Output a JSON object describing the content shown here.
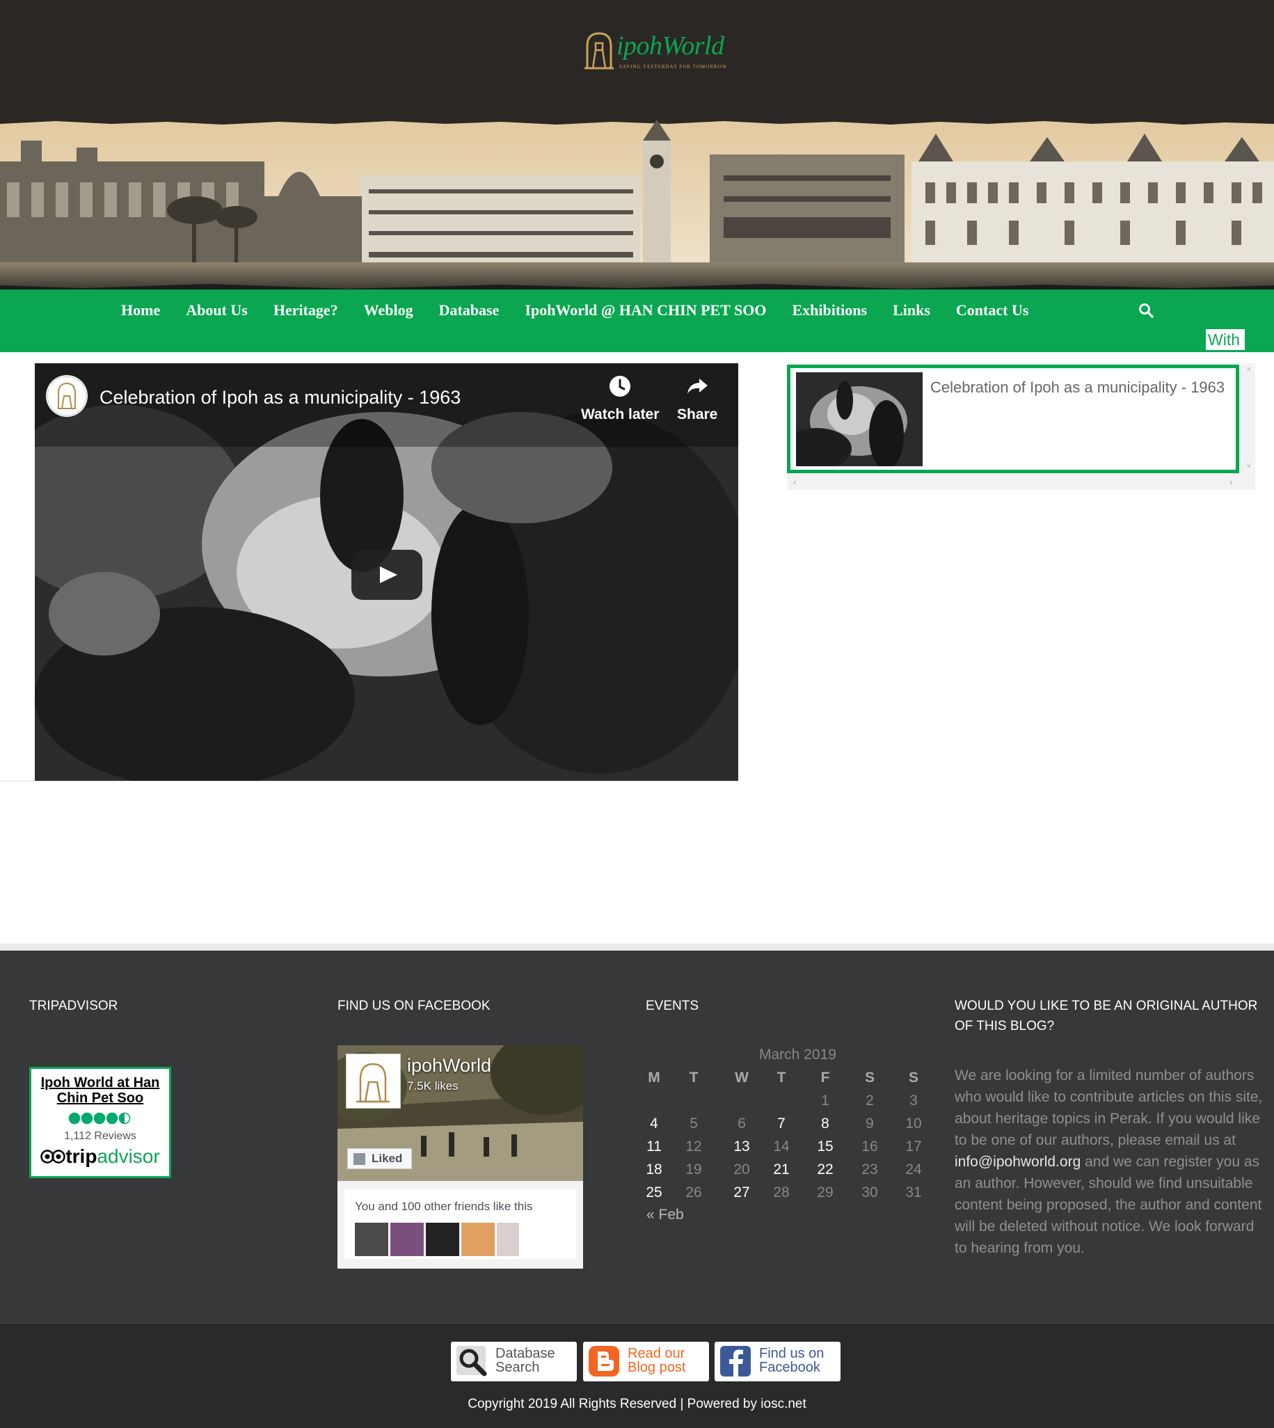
{
  "header": {
    "logo_text": "ipohWorld",
    "logo_tagline": "SAVING YESTERDAY FOR TOMORROW"
  },
  "nav": {
    "items": [
      "Home",
      "About Us",
      "Heritage?",
      "Weblog",
      "Database",
      "IpohWorld @ HAN CHIN PET SOO",
      "Exhibitions",
      "Links",
      "Contact Us"
    ],
    "ticker": "With r"
  },
  "video": {
    "title": "Celebration of Ipoh as a municipality - 1963",
    "watch_later": "Watch later",
    "share": "Share"
  },
  "playlist": {
    "items": [
      {
        "title": "Celebration of Ipoh as a municipality - 1963"
      }
    ]
  },
  "footer": {
    "tripadvisor": {
      "heading": "TRIPADVISOR",
      "title": "Ipoh World at Han Chin Pet Soo",
      "rating": 4.5,
      "reviews": "1,112 Reviews",
      "brand_a": "trip",
      "brand_b": "advisor"
    },
    "facebook": {
      "heading": "FIND US ON FACEBOOK",
      "page_name": "ipohWorld",
      "likes": "7.5K likes",
      "liked_button": "Liked",
      "friends_text": "You and 100 other friends like this"
    },
    "events": {
      "heading": "EVENTS",
      "caption": "March 2019",
      "weekdays": [
        "M",
        "T",
        "W",
        "T",
        "F",
        "S",
        "S"
      ],
      "rows": [
        [
          "",
          "",
          "",
          "",
          "1",
          "2",
          "3"
        ],
        [
          "4",
          "5",
          "6",
          "7",
          "8",
          "9",
          "10"
        ],
        [
          "11",
          "12",
          "13",
          "14",
          "15",
          "16",
          "17"
        ],
        [
          "18",
          "19",
          "20",
          "21",
          "22",
          "23",
          "24"
        ],
        [
          "25",
          "26",
          "27",
          "28",
          "29",
          "30",
          "31"
        ]
      ],
      "event_days": [
        "4",
        "7",
        "8",
        "11",
        "13",
        "15",
        "18",
        "21",
        "22",
        "25",
        "27"
      ],
      "prev_link": "« Feb"
    },
    "author": {
      "heading": "WOULD YOU LIKE TO BE AN ORIGINAL AUTHOR OF THIS BLOG?",
      "text_before": "We are looking for a limited number of authors who would like to contribute articles on this site, about heritage topics in Perak. If you would like to be one of our authors, please email us at ",
      "email": "info@ipohworld.org",
      "text_after": " and we can register you as an author. However, should we find unsuitable content being proposed, the author and content will be deleted without notice. We look forward to hearing from you."
    }
  },
  "bottom": {
    "buttons": [
      {
        "line1": "Database",
        "line2": "Search",
        "color": "#555555"
      },
      {
        "line1": "Read our",
        "line2": "Blog post",
        "color": "#f26522"
      },
      {
        "line1": "Find us on",
        "line2": "Facebook",
        "color": "#3b5998"
      }
    ],
    "copyright": "Copyright 2019 All Rights Reserved | Powered by iosc.net"
  },
  "colors": {
    "accent": "#0aa651",
    "header_bg": "#2b2724",
    "footer_bg": "#363839"
  }
}
